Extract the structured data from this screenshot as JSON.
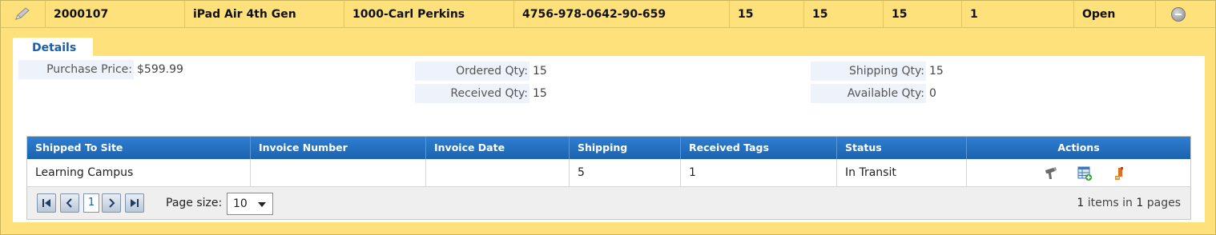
{
  "top_row": {
    "id": "2000107",
    "product": "iPad Air 4th Gen",
    "requester": "1000-Carl Perkins",
    "isbn": "4756-978-0642-90-659",
    "qty1": "15",
    "qty2": "15",
    "qty3": "15",
    "qty4": "1",
    "status": "Open"
  },
  "details": {
    "tab_label": "Details",
    "purchase_price_label": "Purchase Price:",
    "purchase_price": "$599.99",
    "ordered_qty_label": "Ordered Qty:",
    "ordered_qty": "15",
    "received_qty_label": "Received Qty:",
    "received_qty": "15",
    "shipping_qty_label": "Shipping Qty:",
    "shipping_qty": "15",
    "available_qty_label": "Available Qty:",
    "available_qty": "0"
  },
  "grid": {
    "headers": [
      "Shipped To Site",
      "Invoice Number",
      "Invoice Date",
      "Shipping",
      "Received Tags",
      "Status",
      "Actions"
    ],
    "rows": [
      {
        "site": "Learning Campus",
        "invoice_number": "",
        "invoice_date": "",
        "shipping": "5",
        "received_tags": "1",
        "status": "In Transit"
      }
    ],
    "action_icons": [
      "scanner-icon",
      "add-to-table-icon",
      "export-icon"
    ]
  },
  "pager": {
    "first_label": "K",
    "prev_label": "<",
    "current_page": "1",
    "next_label": ">",
    "last_label": ">|",
    "page_size_label": "Page size:",
    "page_size": "10",
    "items_count": "1",
    "items_text": "items in",
    "pages_count": "1",
    "pages_text": "pages"
  },
  "colors": {
    "row_highlight": "#fee17a",
    "header_blue": "#1b63b0",
    "tab_text": "#1a5ea8",
    "label_bg": "#eef2fa"
  }
}
